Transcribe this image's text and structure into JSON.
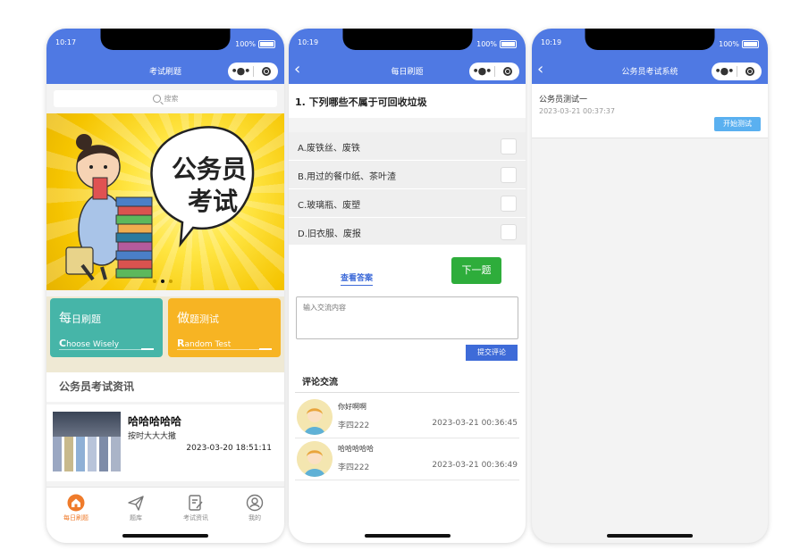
{
  "status": {
    "time1": "10:17",
    "time2": "10:19",
    "time3": "10:19",
    "battery": "100%"
  },
  "capsule": {
    "menu_icon": "more-dots-icon",
    "close_icon": "target-circle-icon"
  },
  "phone1": {
    "nav_title": "考试刷题",
    "search_placeholder": "搜索",
    "banner": {
      "text_line1": "公务员",
      "text_line2": "考试"
    },
    "cards": [
      {
        "title_big": "每",
        "title_rest": "日刷题",
        "en_big": "C",
        "en_rest": "hoose Wisely",
        "color": "#46b5a8"
      },
      {
        "title_big": "做",
        "title_rest": "题测试",
        "en_big": "R",
        "en_rest": "andom Test",
        "color": "#f7b423"
      }
    ],
    "news_section_title": "公务员考试资讯",
    "news": [
      {
        "title": "哈哈哈哈哈",
        "summary": "按时大大大撒",
        "date": "2023-03-20 18:51:11"
      }
    ],
    "tabs": [
      {
        "label": "每日刷题",
        "icon": "home-icon",
        "active": true
      },
      {
        "label": "题库",
        "icon": "paper-plane-icon",
        "active": false
      },
      {
        "label": "考试资讯",
        "icon": "document-edit-icon",
        "active": false
      },
      {
        "label": "我的",
        "icon": "user-circle-icon",
        "active": false
      }
    ]
  },
  "phone2": {
    "nav_title": "每日刷题",
    "question": "1. 下列哪些不属于可回收垃圾",
    "options": [
      "A.废铁丝、废铁",
      "B.用过的餐巾纸、茶叶渣",
      "C.玻璃瓶、废塑",
      "D.旧衣服、废报"
    ],
    "view_answer": "查看答案",
    "next": "下一题",
    "comment_placeholder": "输入交流内容",
    "submit": "提交评论",
    "comments_title": "评论交流",
    "comments": [
      {
        "content": "你好啊啊",
        "user": "李四222",
        "date": "2023-03-21 00:36:45"
      },
      {
        "content": "哈哈哈哈哈",
        "user": "李四222",
        "date": "2023-03-21 00:36:49"
      }
    ]
  },
  "phone3": {
    "nav_title": "公务员考试系统",
    "exams": [
      {
        "name": "公务员测试一",
        "date": "2023-03-21 00:37:37",
        "button": "开始测试"
      }
    ]
  },
  "colors": {
    "nav_blue": "#4f79e3",
    "active_tab": "#ef7b2b",
    "next_green": "#2ead3b",
    "link_blue": "#3e6bd8",
    "start_blue": "#5ab0f0"
  }
}
